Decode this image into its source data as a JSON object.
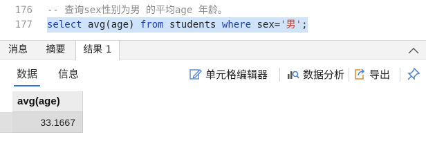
{
  "editor": {
    "lines": [
      {
        "number": "176",
        "text": "-- 查询sex性别为男 的平均age 年龄。"
      },
      {
        "number": "177",
        "tokens": {
          "select": "select",
          "func": " avg(age) ",
          "from": "from",
          "table": " students ",
          "where": "where",
          "cond": " sex=",
          "value": "'男'",
          "end": ";"
        }
      }
    ]
  },
  "bottom_tabs": [
    {
      "label": "消息"
    },
    {
      "label": "摘要"
    },
    {
      "label": "结果 1",
      "active": true
    }
  ],
  "result_toolbar": {
    "tabs": [
      {
        "label": "数据",
        "active": true
      },
      {
        "label": "信息"
      }
    ],
    "tools": {
      "cell_editor": "单元格编辑器",
      "data_analysis": "数据分析",
      "export": "导出"
    }
  },
  "grid": {
    "columns": [
      "avg(age)"
    ],
    "rows": [
      [
        "33.1667"
      ]
    ]
  },
  "colors": {
    "selection": "#cfe3fa",
    "keyword": "#1f3fb8",
    "string": "#c0392b",
    "comment": "#8a8a8a",
    "accent": "#2f6fe0"
  },
  "icons": [
    "collapse-chevron-up-icon",
    "edit-pencil-icon",
    "data-analysis-icon",
    "export-icon",
    "pin-icon"
  ]
}
